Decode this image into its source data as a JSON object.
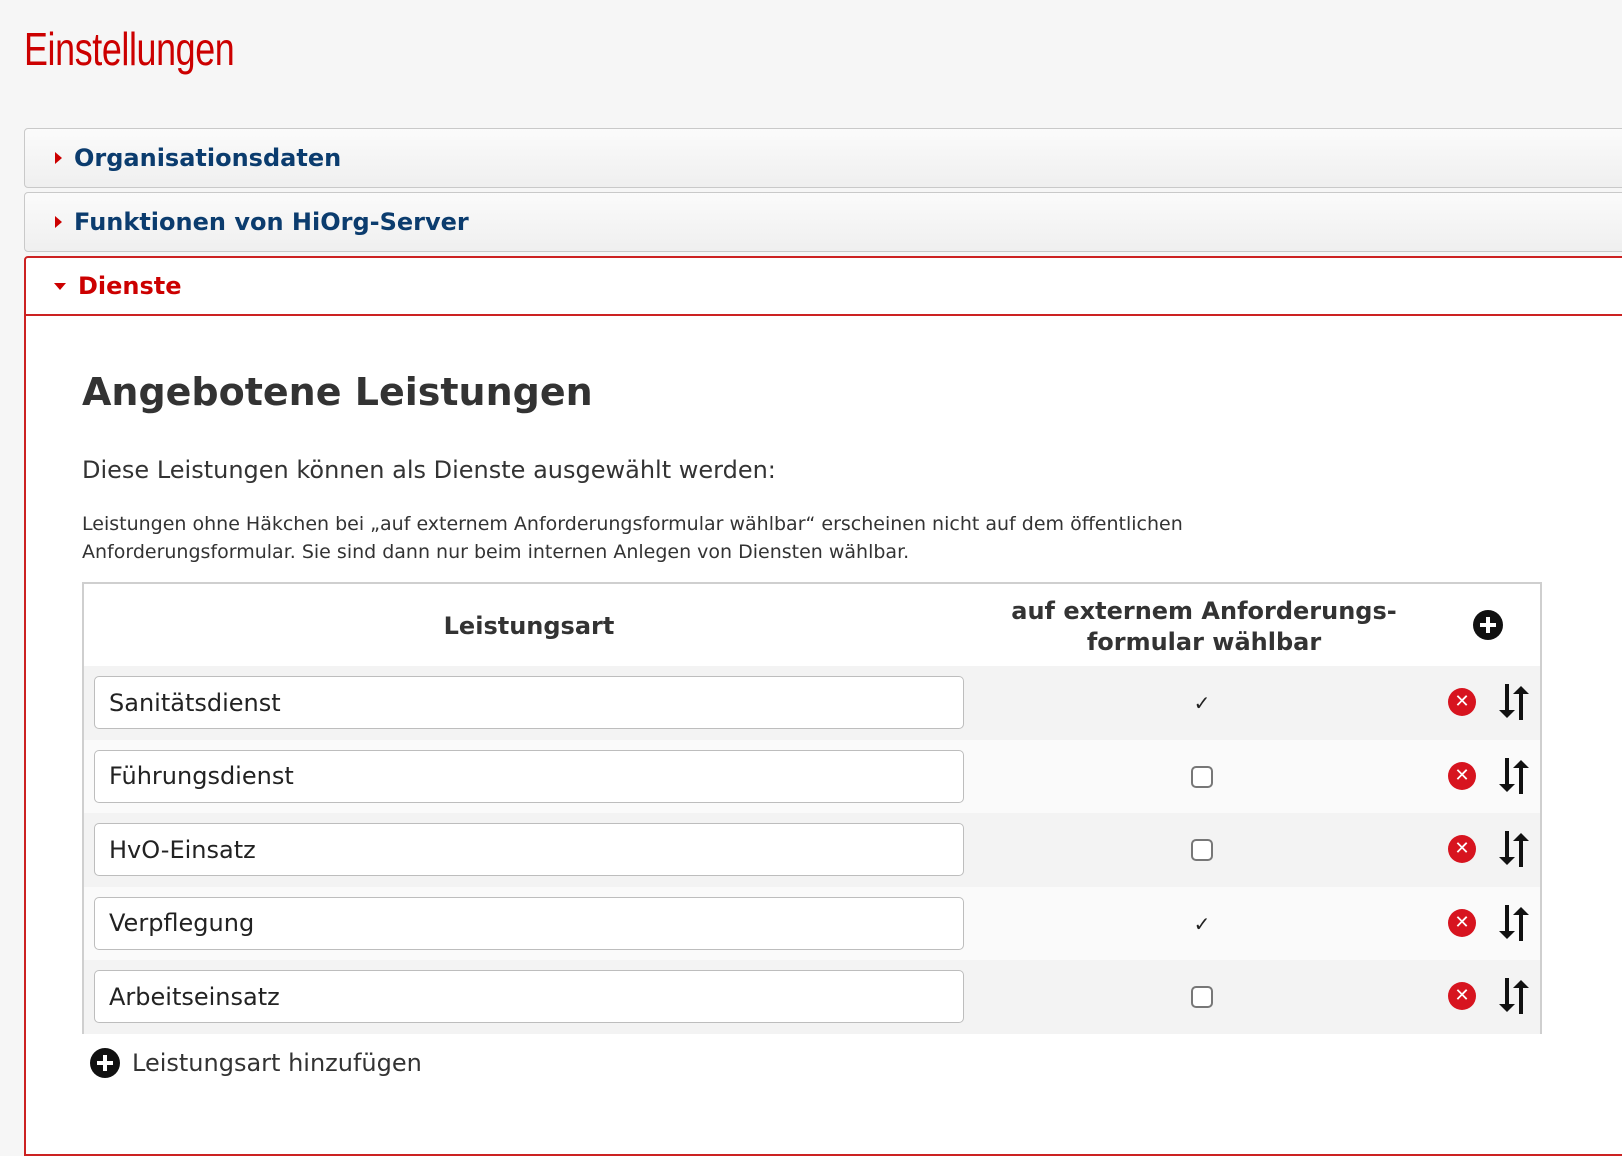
{
  "page": {
    "title": "Einstellungen"
  },
  "accordion": {
    "sections": [
      {
        "label": "Organisationsdaten"
      },
      {
        "label": "Funktionen von HiOrg-Server"
      },
      {
        "label": "Dienste"
      }
    ]
  },
  "dienste": {
    "heading": "Angebotene Leistungen",
    "lead": "Diese Leistungen können als Dienste ausgewählt werden:",
    "note": "Leistungen ohne Häkchen bei „auf externem Anforderungsformular wählbar“ erscheinen nicht auf dem öffentlichen Anforderungsformular. Sie sind dann nur beim internen Anlegen von Diensten wählbar.",
    "table": {
      "col_art": "Leistungsart",
      "col_ext_line1": "auf externem Anforderungs-",
      "col_ext_line2": "formular wählbar",
      "rows": [
        {
          "name": "Sanitätsdienst",
          "external": true
        },
        {
          "name": "Führungsdienst",
          "external": false
        },
        {
          "name": "HvO-Einsatz",
          "external": false
        },
        {
          "name": "Verpflegung",
          "external": true
        },
        {
          "name": "Arbeitseinsatz",
          "external": false
        }
      ]
    },
    "add_label": "Leistungsart hinzufügen"
  },
  "icons": {
    "collapsed": "triangle-right-icon",
    "expanded": "triangle-down-icon",
    "add": "plus-circle-icon",
    "delete": "delete-circle-icon",
    "sort": "sort-arrows-icon"
  },
  "colors": {
    "accent": "#cc0000",
    "link": "#0b3c6e",
    "delete": "#d7141f"
  }
}
